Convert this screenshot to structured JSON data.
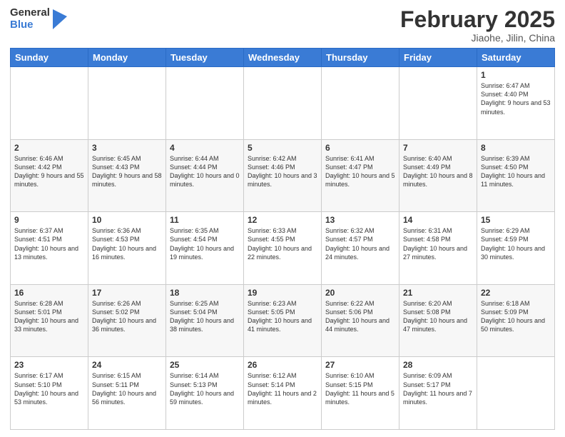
{
  "header": {
    "logo_general": "General",
    "logo_blue": "Blue",
    "month_title": "February 2025",
    "subtitle": "Jiaohe, Jilin, China"
  },
  "days_of_week": [
    "Sunday",
    "Monday",
    "Tuesday",
    "Wednesday",
    "Thursday",
    "Friday",
    "Saturday"
  ],
  "weeks": [
    [
      {
        "day": "",
        "info": ""
      },
      {
        "day": "",
        "info": ""
      },
      {
        "day": "",
        "info": ""
      },
      {
        "day": "",
        "info": ""
      },
      {
        "day": "",
        "info": ""
      },
      {
        "day": "",
        "info": ""
      },
      {
        "day": "1",
        "info": "Sunrise: 6:47 AM\nSunset: 4:40 PM\nDaylight: 9 hours and 53 minutes."
      }
    ],
    [
      {
        "day": "2",
        "info": "Sunrise: 6:46 AM\nSunset: 4:42 PM\nDaylight: 9 hours and 55 minutes."
      },
      {
        "day": "3",
        "info": "Sunrise: 6:45 AM\nSunset: 4:43 PM\nDaylight: 9 hours and 58 minutes."
      },
      {
        "day": "4",
        "info": "Sunrise: 6:44 AM\nSunset: 4:44 PM\nDaylight: 10 hours and 0 minutes."
      },
      {
        "day": "5",
        "info": "Sunrise: 6:42 AM\nSunset: 4:46 PM\nDaylight: 10 hours and 3 minutes."
      },
      {
        "day": "6",
        "info": "Sunrise: 6:41 AM\nSunset: 4:47 PM\nDaylight: 10 hours and 5 minutes."
      },
      {
        "day": "7",
        "info": "Sunrise: 6:40 AM\nSunset: 4:49 PM\nDaylight: 10 hours and 8 minutes."
      },
      {
        "day": "8",
        "info": "Sunrise: 6:39 AM\nSunset: 4:50 PM\nDaylight: 10 hours and 11 minutes."
      }
    ],
    [
      {
        "day": "9",
        "info": "Sunrise: 6:37 AM\nSunset: 4:51 PM\nDaylight: 10 hours and 13 minutes."
      },
      {
        "day": "10",
        "info": "Sunrise: 6:36 AM\nSunset: 4:53 PM\nDaylight: 10 hours and 16 minutes."
      },
      {
        "day": "11",
        "info": "Sunrise: 6:35 AM\nSunset: 4:54 PM\nDaylight: 10 hours and 19 minutes."
      },
      {
        "day": "12",
        "info": "Sunrise: 6:33 AM\nSunset: 4:55 PM\nDaylight: 10 hours and 22 minutes."
      },
      {
        "day": "13",
        "info": "Sunrise: 6:32 AM\nSunset: 4:57 PM\nDaylight: 10 hours and 24 minutes."
      },
      {
        "day": "14",
        "info": "Sunrise: 6:31 AM\nSunset: 4:58 PM\nDaylight: 10 hours and 27 minutes."
      },
      {
        "day": "15",
        "info": "Sunrise: 6:29 AM\nSunset: 4:59 PM\nDaylight: 10 hours and 30 minutes."
      }
    ],
    [
      {
        "day": "16",
        "info": "Sunrise: 6:28 AM\nSunset: 5:01 PM\nDaylight: 10 hours and 33 minutes."
      },
      {
        "day": "17",
        "info": "Sunrise: 6:26 AM\nSunset: 5:02 PM\nDaylight: 10 hours and 36 minutes."
      },
      {
        "day": "18",
        "info": "Sunrise: 6:25 AM\nSunset: 5:04 PM\nDaylight: 10 hours and 38 minutes."
      },
      {
        "day": "19",
        "info": "Sunrise: 6:23 AM\nSunset: 5:05 PM\nDaylight: 10 hours and 41 minutes."
      },
      {
        "day": "20",
        "info": "Sunrise: 6:22 AM\nSunset: 5:06 PM\nDaylight: 10 hours and 44 minutes."
      },
      {
        "day": "21",
        "info": "Sunrise: 6:20 AM\nSunset: 5:08 PM\nDaylight: 10 hours and 47 minutes."
      },
      {
        "day": "22",
        "info": "Sunrise: 6:18 AM\nSunset: 5:09 PM\nDaylight: 10 hours and 50 minutes."
      }
    ],
    [
      {
        "day": "23",
        "info": "Sunrise: 6:17 AM\nSunset: 5:10 PM\nDaylight: 10 hours and 53 minutes."
      },
      {
        "day": "24",
        "info": "Sunrise: 6:15 AM\nSunset: 5:11 PM\nDaylight: 10 hours and 56 minutes."
      },
      {
        "day": "25",
        "info": "Sunrise: 6:14 AM\nSunset: 5:13 PM\nDaylight: 10 hours and 59 minutes."
      },
      {
        "day": "26",
        "info": "Sunrise: 6:12 AM\nSunset: 5:14 PM\nDaylight: 11 hours and 2 minutes."
      },
      {
        "day": "27",
        "info": "Sunrise: 6:10 AM\nSunset: 5:15 PM\nDaylight: 11 hours and 5 minutes."
      },
      {
        "day": "28",
        "info": "Sunrise: 6:09 AM\nSunset: 5:17 PM\nDaylight: 11 hours and 7 minutes."
      },
      {
        "day": "",
        "info": ""
      }
    ]
  ]
}
